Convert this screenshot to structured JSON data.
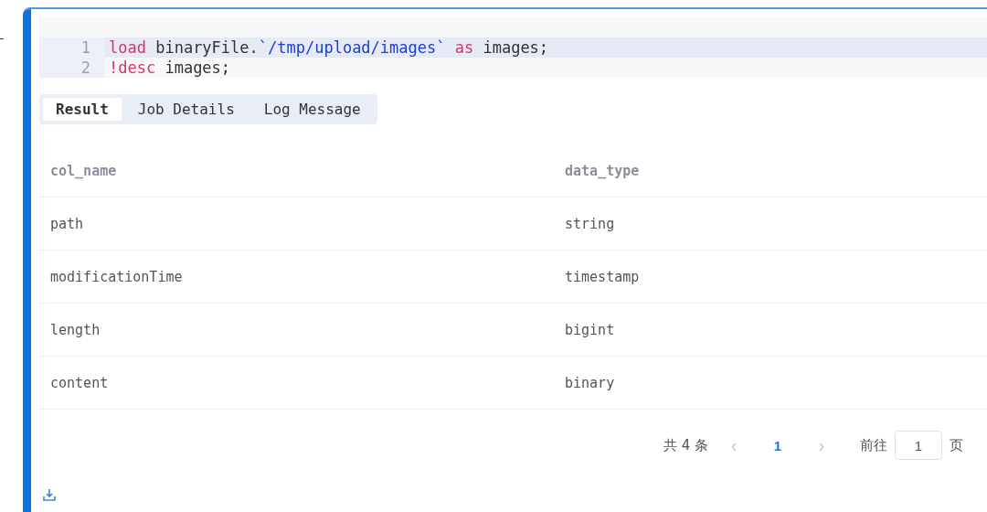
{
  "editor": {
    "lines": [
      {
        "number": "1",
        "highlighted": true,
        "tokens": [
          {
            "kind": "keyword",
            "text": "load"
          },
          {
            "kind": "plain",
            "text": " binaryFile."
          },
          {
            "kind": "string",
            "text": "`/tmp/upload/images`"
          },
          {
            "kind": "keyword",
            "text": " as"
          },
          {
            "kind": "plain",
            "text": " images;"
          }
        ]
      },
      {
        "number": "2",
        "highlighted": false,
        "tokens": [
          {
            "kind": "keyword",
            "text": "!desc"
          },
          {
            "kind": "plain",
            "text": " images;"
          }
        ]
      }
    ]
  },
  "tabs": [
    {
      "label": "Result",
      "selected": true
    },
    {
      "label": "Job Details",
      "selected": false
    },
    {
      "label": "Log Message",
      "selected": false
    }
  ],
  "table": {
    "columns": [
      "col_name",
      "data_type"
    ],
    "rows": [
      [
        "path",
        "string"
      ],
      [
        "modificationTime",
        "timestamp"
      ],
      [
        "length",
        "bigint"
      ],
      [
        "content",
        "binary"
      ]
    ]
  },
  "pagination": {
    "total": "共 4 条",
    "prev": "‹",
    "pages": [
      {
        "label": "1",
        "selected": true
      }
    ],
    "next": "›",
    "goto_label": "前往",
    "goto_value": "1",
    "page_suffix": "页"
  }
}
